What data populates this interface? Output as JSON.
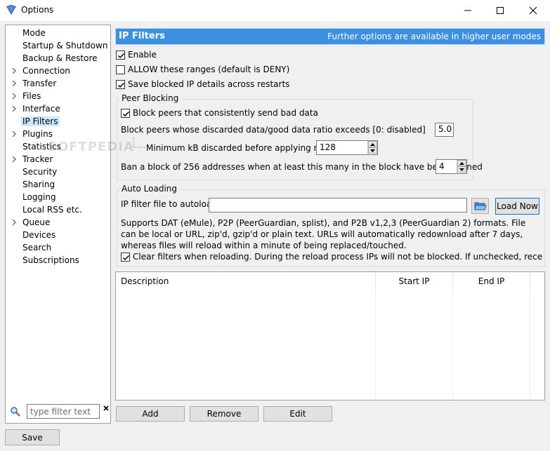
{
  "window": {
    "title": "Options"
  },
  "sidebar": {
    "items": [
      {
        "label": "Mode",
        "expandable": false,
        "selected": false
      },
      {
        "label": "Startup & Shutdown",
        "expandable": false,
        "selected": false
      },
      {
        "label": "Backup & Restore",
        "expandable": false,
        "selected": false
      },
      {
        "label": "Connection",
        "expandable": true,
        "selected": false
      },
      {
        "label": "Transfer",
        "expandable": true,
        "selected": false
      },
      {
        "label": "Files",
        "expandable": true,
        "selected": false
      },
      {
        "label": "Interface",
        "expandable": true,
        "selected": false
      },
      {
        "label": "IP Filters",
        "expandable": false,
        "selected": true
      },
      {
        "label": "Plugins",
        "expandable": true,
        "selected": false
      },
      {
        "label": "Statistics",
        "expandable": false,
        "selected": false
      },
      {
        "label": "Tracker",
        "expandable": true,
        "selected": false
      },
      {
        "label": "Security",
        "expandable": false,
        "selected": false
      },
      {
        "label": "Sharing",
        "expandable": false,
        "selected": false
      },
      {
        "label": "Logging",
        "expandable": false,
        "selected": false
      },
      {
        "label": "Local RSS etc.",
        "expandable": false,
        "selected": false
      },
      {
        "label": "Queue",
        "expandable": true,
        "selected": false
      },
      {
        "label": "Devices",
        "expandable": false,
        "selected": false
      },
      {
        "label": "Search",
        "expandable": false,
        "selected": false
      },
      {
        "label": "Subscriptions",
        "expandable": false,
        "selected": false
      }
    ],
    "filter_placeholder": "type filter text",
    "filter_value": ""
  },
  "header": {
    "title": "IP Filters",
    "note": "Further options are available in higher user modes"
  },
  "options": {
    "enable": {
      "label": "Enable",
      "checked": true
    },
    "allow": {
      "label": "ALLOW these ranges (default is DENY)",
      "checked": false
    },
    "save_blocked": {
      "label": "Save blocked IP details across restarts",
      "checked": true
    }
  },
  "peer_blocking": {
    "title": "Peer Blocking",
    "block_bad": {
      "label": "Block peers that consistently send bad data",
      "checked": true
    },
    "ratio_label": "Block peers whose discarded data/good data ratio exceeds [0: disabled]",
    "ratio_value": "5.0",
    "min_kb_label": "Minimum kB discarded before applying ratio",
    "min_kb_value": "128",
    "ban_label": "Ban a block of 256 addresses when at least this many in the block have been banned",
    "ban_value": "4"
  },
  "auto_loading": {
    "title": "Auto Loading",
    "file_label": "IP filter file to autoload",
    "file_value": "",
    "load_now": "Load Now",
    "description": "Supports DAT (eMule), P2P (PeerGuardian, splist), and P2B v1,2,3 (PeerGuardian 2) formats.  File can be local or URL, zip'd, gzip'd or plain text.  URLs will automatically redownload after 7 days, whereas files will reload within a minute of being replaced/touched.",
    "clear_filters": {
      "label": "Clear filters when reloading. During the reload process IPs will not be blocked. If unchecked, recent un-blocks w",
      "checked": true
    }
  },
  "table": {
    "columns": [
      "Description",
      "Start IP",
      "End IP"
    ],
    "rows": []
  },
  "buttons": {
    "add": "Add",
    "remove": "Remove",
    "edit": "Edit",
    "save": "Save"
  },
  "watermark": "SOFTPEDIA",
  "colors": {
    "header_bg": "#3d8fe0",
    "selection": "#cce8ff"
  }
}
